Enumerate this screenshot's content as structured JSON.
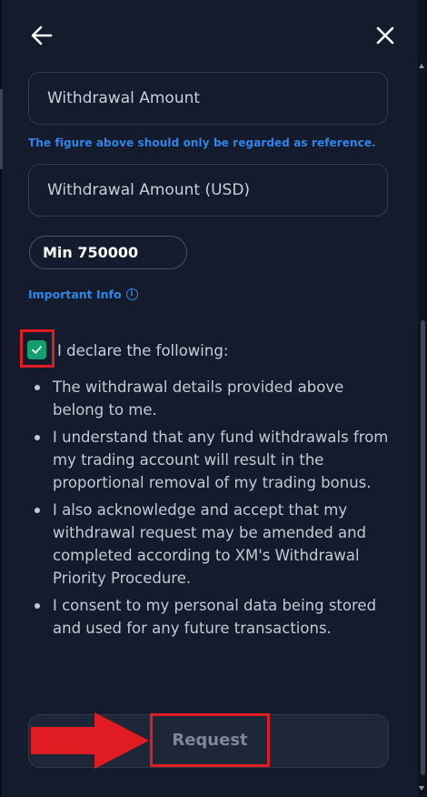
{
  "header": {
    "back_icon": "arrow-left-icon",
    "close_icon": "close-icon"
  },
  "form": {
    "withdrawal_amount_placeholder": "Withdrawal Amount",
    "reference_hint": "The figure above should only be regarded as reference.",
    "withdrawal_amount_usd_placeholder": "Withdrawal Amount (USD)",
    "min_value": "Min 750000",
    "important_info_label": "Important Info",
    "info_icon": "info-circle-icon"
  },
  "declaration": {
    "checked": true,
    "title": "I declare the following:",
    "items": [
      "The withdrawal details provided above belong to me.",
      "I understand that any fund withdrawals from my trading account will result in the proportional removal of my trading bonus.",
      "I also acknowledge and accept that my withdrawal request may be amended and completed according to XM's Withdrawal Priority Procedure.",
      "I consent to my personal data being stored and used for any future transactions."
    ]
  },
  "actions": {
    "request_label": "Request"
  },
  "colors": {
    "background": "#131b2c",
    "accent_blue": "#2f86e8",
    "checkbox_green": "#13a070",
    "highlight_red": "#e11b22"
  }
}
